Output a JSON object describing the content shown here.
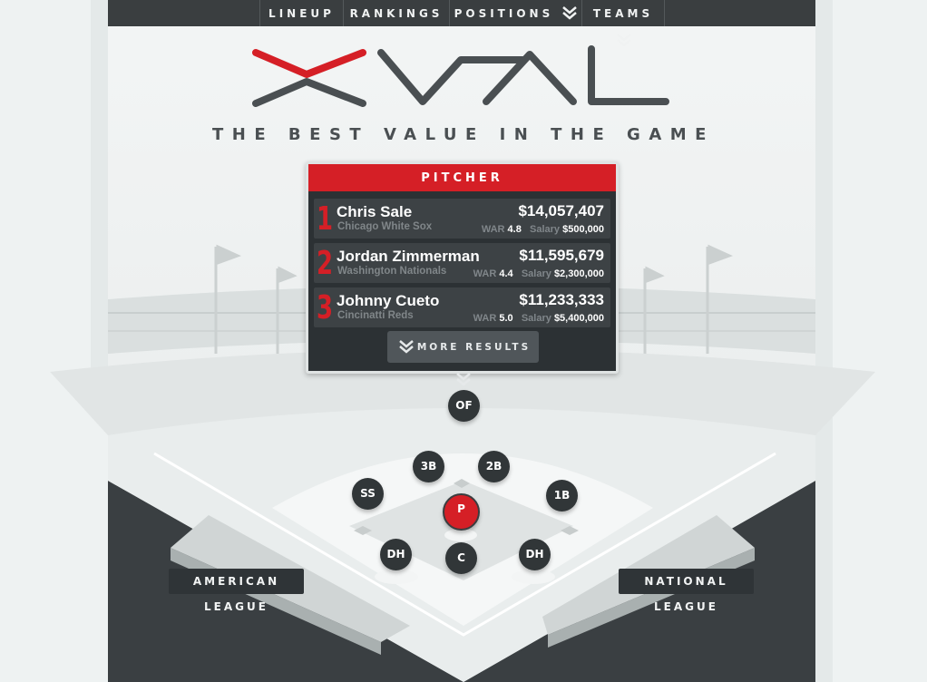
{
  "nav": {
    "items": [
      {
        "label": "LINEUP",
        "has_chevron": false
      },
      {
        "label": "RANKINGS",
        "has_chevron": false
      },
      {
        "label": "POSITIONS",
        "has_chevron": true
      },
      {
        "label": "TEAMS",
        "has_chevron": true
      }
    ]
  },
  "logo": {
    "text": "XVAL",
    "accent_color": "#d51f26",
    "color": "#4a4f52"
  },
  "tagline": "THE BEST VALUE IN THE GAME",
  "panel": {
    "header": "PITCHER",
    "players": [
      {
        "rank": "1",
        "name": "Chris Sale",
        "team": "Chicago White Sox",
        "value": "$14,057,407",
        "war_label": "WAR",
        "war": "4.8",
        "salary_label": "Salary",
        "salary": "$500,000"
      },
      {
        "rank": "2",
        "name": "Jordan Zimmerman",
        "team": "Washington Nationals",
        "value": "$11,595,679",
        "war_label": "WAR",
        "war": "4.4",
        "salary_label": "Salary",
        "salary": "$2,300,000"
      },
      {
        "rank": "3",
        "name": "Johnny Cueto",
        "team": "Cincinatti Reds",
        "value": "$11,233,333",
        "war_label": "WAR",
        "war": "5.0",
        "salary_label": "Salary",
        "salary": "$5,400,000"
      }
    ],
    "more_label": "MORE RESULTS"
  },
  "positions": {
    "of": "OF",
    "third": "3B",
    "second": "2B",
    "ss": "SS",
    "first": "1B",
    "pitcher": "P",
    "dh_left": "DH",
    "catcher": "C",
    "dh_right": "DH",
    "selected": "P"
  },
  "leagues": {
    "american": "AMERICAN LEAGUE",
    "national": "NATIONAL LEAGUE"
  },
  "colors": {
    "accent": "#d51f26",
    "dark": "#2c3134",
    "nav": "#3a3e40"
  }
}
